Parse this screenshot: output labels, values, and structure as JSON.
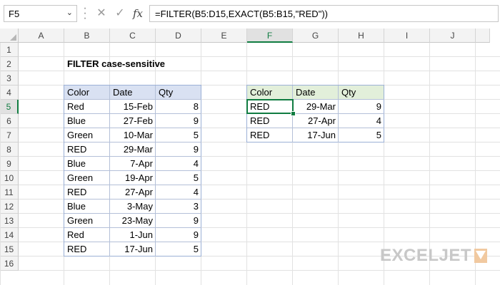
{
  "formula_bar": {
    "name_box": "F5",
    "formula": "=FILTER(B5:D15,EXACT(B5:B15,\"RED\"))",
    "cancel_glyph": "✕",
    "enter_glyph": "✓",
    "fx_glyph": "fx"
  },
  "columns": [
    "A",
    "B",
    "C",
    "D",
    "E",
    "F",
    "G",
    "H",
    "I",
    "J"
  ],
  "rows": [
    "1",
    "2",
    "3",
    "4",
    "5",
    "6",
    "7",
    "8",
    "9",
    "10",
    "11",
    "12",
    "13",
    "14",
    "15",
    "16"
  ],
  "sheet": {
    "title": "FILTER case-sensitive",
    "source_headers": [
      "Color",
      "Date",
      "Qty"
    ],
    "source_rows": [
      [
        "Red",
        "15-Feb",
        "8"
      ],
      [
        "Blue",
        "27-Feb",
        "9"
      ],
      [
        "Green",
        "10-Mar",
        "5"
      ],
      [
        "RED",
        "29-Mar",
        "9"
      ],
      [
        "Blue",
        "7-Apr",
        "4"
      ],
      [
        "Green",
        "19-Apr",
        "5"
      ],
      [
        "RED",
        "27-Apr",
        "4"
      ],
      [
        "Blue",
        "3-May",
        "3"
      ],
      [
        "Green",
        "23-May",
        "9"
      ],
      [
        "Red",
        "1-Jun",
        "9"
      ],
      [
        "RED",
        "17-Jun",
        "5"
      ]
    ],
    "result_headers": [
      "Color",
      "Date",
      "Qty"
    ],
    "result_rows": [
      [
        "RED",
        "29-Mar",
        "9"
      ],
      [
        "RED",
        "27-Apr",
        "4"
      ],
      [
        "RED",
        "17-Jun",
        "5"
      ]
    ]
  },
  "watermark": "EXCELJET",
  "colors": {
    "accent": "#107c41",
    "header_blue": "#d9e1f2",
    "header_green": "#e2efda"
  }
}
